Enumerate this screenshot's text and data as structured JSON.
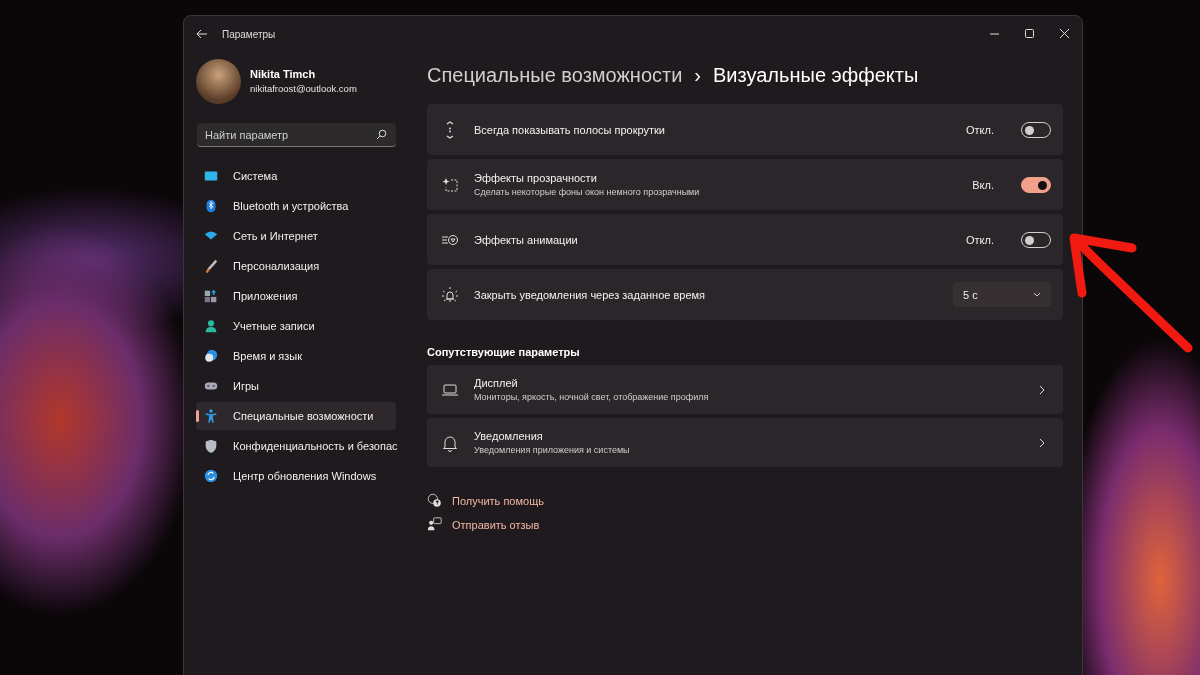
{
  "window": {
    "title": "Параметры"
  },
  "user": {
    "name": "Nikita Timch",
    "email": "nikitafroost@outlook.com"
  },
  "search": {
    "placeholder": "Найти параметр"
  },
  "nav": [
    {
      "label": "Система",
      "selected": false
    },
    {
      "label": "Bluetooth и устройства",
      "selected": false
    },
    {
      "label": "Сеть и Интернет",
      "selected": false
    },
    {
      "label": "Персонализация",
      "selected": false
    },
    {
      "label": "Приложения",
      "selected": false
    },
    {
      "label": "Учетные записи",
      "selected": false
    },
    {
      "label": "Время и язык",
      "selected": false
    },
    {
      "label": "Игры",
      "selected": false
    },
    {
      "label": "Специальные возможности",
      "selected": true
    },
    {
      "label": "Конфиденциальность и безопас",
      "selected": false
    },
    {
      "label": "Центр обновления Windows",
      "selected": false
    }
  ],
  "breadcrumb": {
    "parent": "Специальные возможности",
    "separator": "›",
    "current": "Визуальные эффекты"
  },
  "settings": [
    {
      "kind": "toggle",
      "label": "Всегда показывать полосы прокрутки",
      "state_label": "Откл.",
      "on": false
    },
    {
      "kind": "toggle",
      "label": "Эффекты прозрачности",
      "description": "Сделать некоторые фоны окон немного прозрачными",
      "state_label": "Вкл.",
      "on": true
    },
    {
      "kind": "toggle",
      "label": "Эффекты анимации",
      "state_label": "Откл.",
      "on": false
    },
    {
      "kind": "dropdown",
      "label": "Закрыть уведомления через заданное время",
      "value": "5 с"
    }
  ],
  "related": {
    "heading": "Сопутствующие параметры",
    "items": [
      {
        "label": "Дисплей",
        "description": "Мониторы, яркость, ночной свет, отображение профиля"
      },
      {
        "label": "Уведомления",
        "description": "Уведомления приложения и системы"
      }
    ]
  },
  "links": [
    {
      "label": "Получить помощь"
    },
    {
      "label": "Отправить отзыв"
    }
  ]
}
